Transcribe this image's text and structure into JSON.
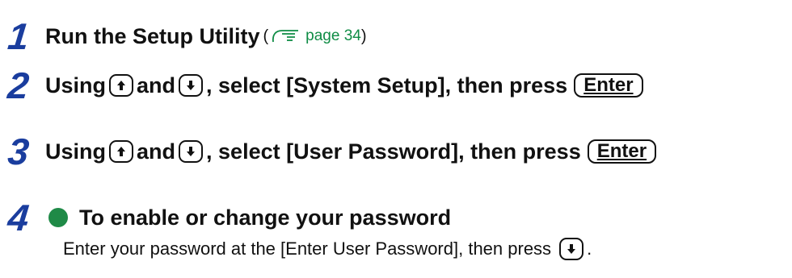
{
  "steps": [
    {
      "number": "1",
      "title": "Run the Setup Utility",
      "ref_open": "(",
      "ref_text": "page 34",
      "ref_close": ")"
    },
    {
      "number": "2",
      "using": "Using",
      "and": "and",
      "mid": ", select [System Setup], then press",
      "enter_key": "Enter"
    },
    {
      "number": "3",
      "using": "Using",
      "and": "and",
      "mid": ", select [User Password], then press",
      "enter_key": "Enter"
    },
    {
      "number": "4",
      "subheading": "To enable or change your password",
      "instruction": "Enter your password at the [Enter User Password], then press",
      "instruction_end": "."
    }
  ],
  "icons": {
    "up_arrow_key": "up-arrow-icon",
    "down_arrow_key": "down-arrow-icon",
    "page_reference": "hand-pointer-icon",
    "bullet": "bullet-icon"
  },
  "colors": {
    "step_number": "#1a3d9e",
    "link": "#0f8c45",
    "bullet": "#1f8a47"
  }
}
